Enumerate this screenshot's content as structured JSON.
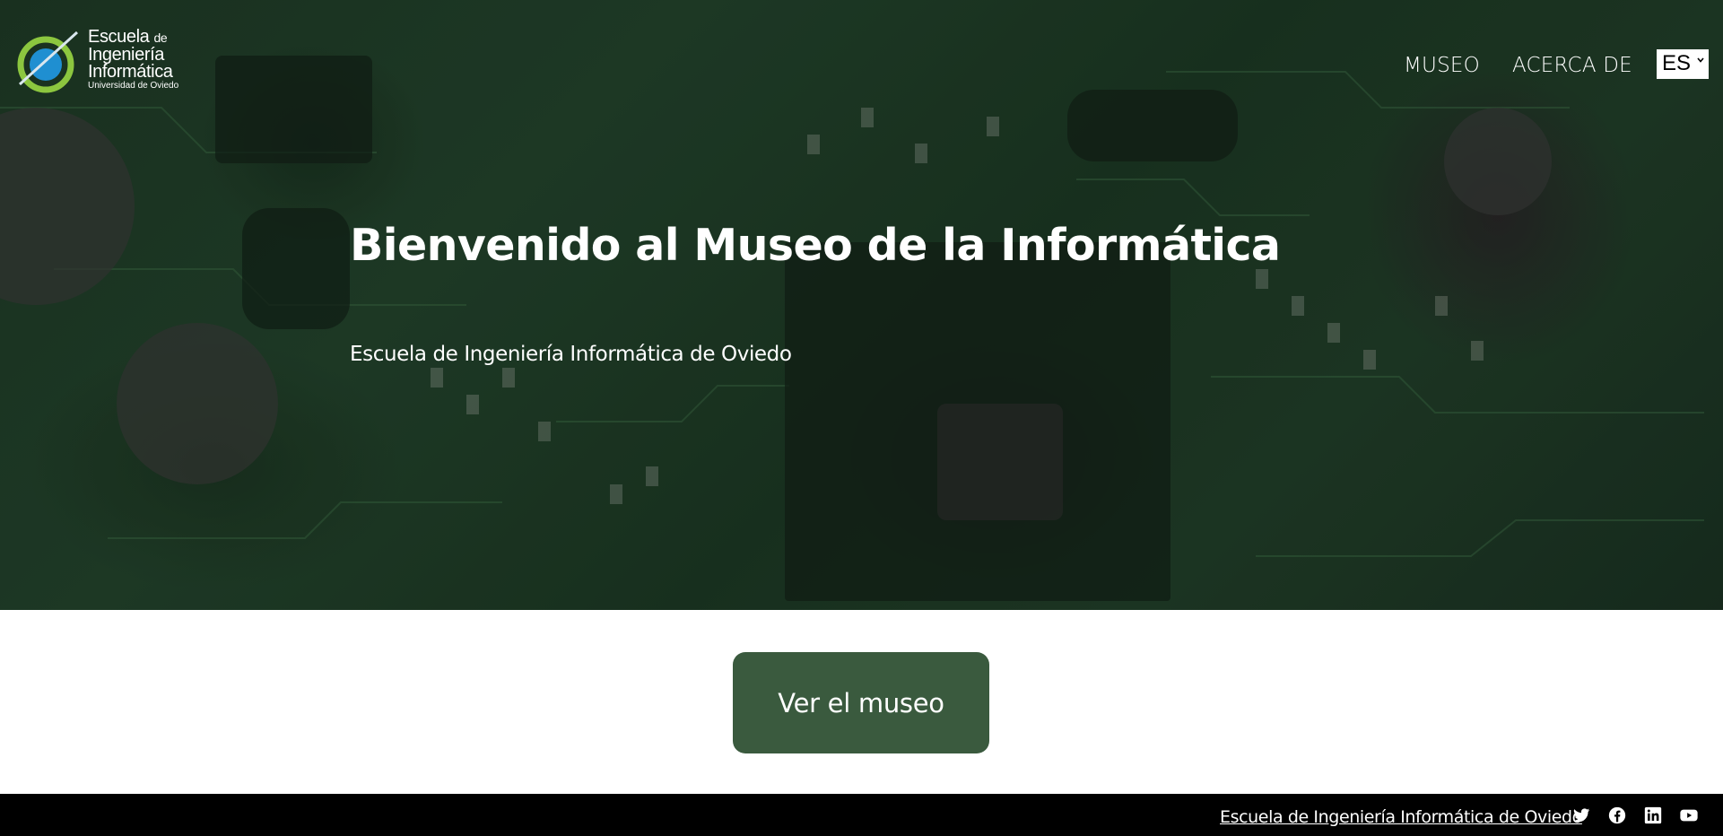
{
  "header": {
    "logo": {
      "line1": "Escuela",
      "line1_small": "de",
      "line2": "Ingeniería",
      "line3": "Informática",
      "line4": "Universidad de Oviedo"
    },
    "nav": [
      {
        "label": "MUSEO"
      },
      {
        "label": "ACERCA DE"
      }
    ],
    "language": {
      "selected": "ES"
    }
  },
  "hero": {
    "title": "Bienvenido al Museo de la Informática",
    "subtitle": "Escuela de Ingeniería Informática de Oviedo"
  },
  "cta": {
    "label": "Ver el museo"
  },
  "footer": {
    "link": "Escuela de Ingeniería Informática de Oviedo",
    "social": [
      "twitter-icon",
      "facebook-icon",
      "linkedin-icon",
      "youtube-icon"
    ]
  },
  "colors": {
    "cta_background": "#3a5a3e",
    "footer_background": "#000000",
    "hero_tint": "#22402a"
  }
}
